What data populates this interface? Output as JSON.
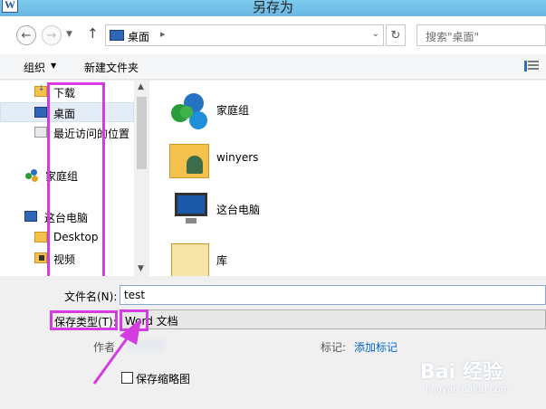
{
  "window": {
    "title": "另存为",
    "app_icon_letter": "W"
  },
  "address": {
    "location": "桌面",
    "search_placeholder": "搜索\"桌面\""
  },
  "toolbar": {
    "organize_label": "组织",
    "new_folder_label": "新建文件夹"
  },
  "nav": {
    "items": [
      {
        "label": "下载",
        "icon": "download-folder-icon"
      },
      {
        "label": "桌面",
        "icon": "desktop-icon",
        "selected": true
      },
      {
        "label": "最近访问的位置",
        "icon": "recent-places-icon"
      },
      {
        "label": "家庭组",
        "icon": "homegroup-icon"
      },
      {
        "label": "这台电脑",
        "icon": "computer-icon"
      },
      {
        "label": "Desktop",
        "icon": "folder-icon"
      },
      {
        "label": "视频",
        "icon": "video-folder-icon"
      }
    ]
  },
  "content": {
    "items": [
      {
        "label": "家庭组",
        "icon": "homegroup-icon"
      },
      {
        "label": "winyers",
        "icon": "user-folder-icon"
      },
      {
        "label": "这台电脑",
        "icon": "computer-icon"
      },
      {
        "label": "库",
        "icon": "library-icon"
      }
    ]
  },
  "form": {
    "filename_label": "文件名(N):",
    "filename_value": "test",
    "filetype_label": "保存类型(T):",
    "filetype_value": "Word 文档",
    "author_label": "作者",
    "tags_label": "标记:",
    "tags_link": "添加标记",
    "thumbnail_label": "保存缩略图"
  },
  "watermark": {
    "main": "Bai 经验",
    "sub": "jingyan.baidu.com"
  },
  "colors": {
    "highlight": "#d43be0",
    "link": "#0066cc",
    "title_bar": "#7ecbf0"
  }
}
